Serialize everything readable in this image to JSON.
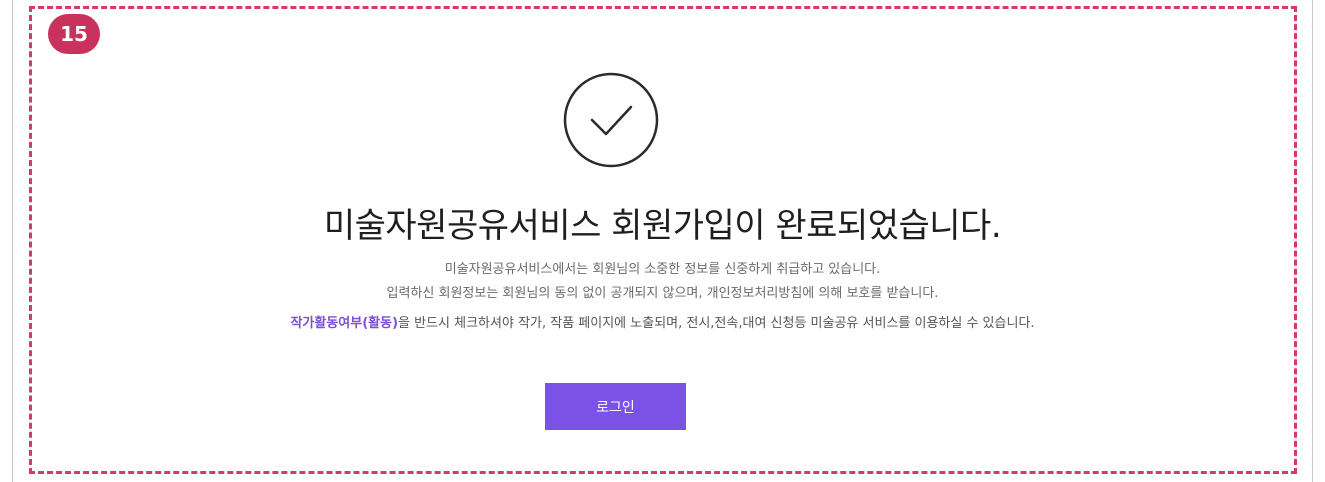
{
  "step_number": "15",
  "title": "미술자원공유서비스 회원가입이 완료되었습니다.",
  "description": {
    "line1": "미술자원공유서비스에서는 회원님의 소중한 정보를 신중하게 취급하고 있습니다.",
    "line2": "입력하신 회원정보는 회원님의 동의 없이 공개되지 않으며, 개인정보처리방침에 의해 보호를 받습니다."
  },
  "notice": {
    "highlight": "작가활동여부(활동)",
    "text": "을 반드시 체크하셔야 작가, 작품 페이지에 노출되며, 전시,전속,대여 신청등 미술공유 서비스를 이용하실 수 있습니다."
  },
  "login_button": "로그인",
  "icons": {
    "success": "check-circle-icon"
  },
  "colors": {
    "accent": "#7a52e6",
    "badge": "#c8325c",
    "frame": "#d63a66",
    "highlight": "#7d4fd8"
  }
}
